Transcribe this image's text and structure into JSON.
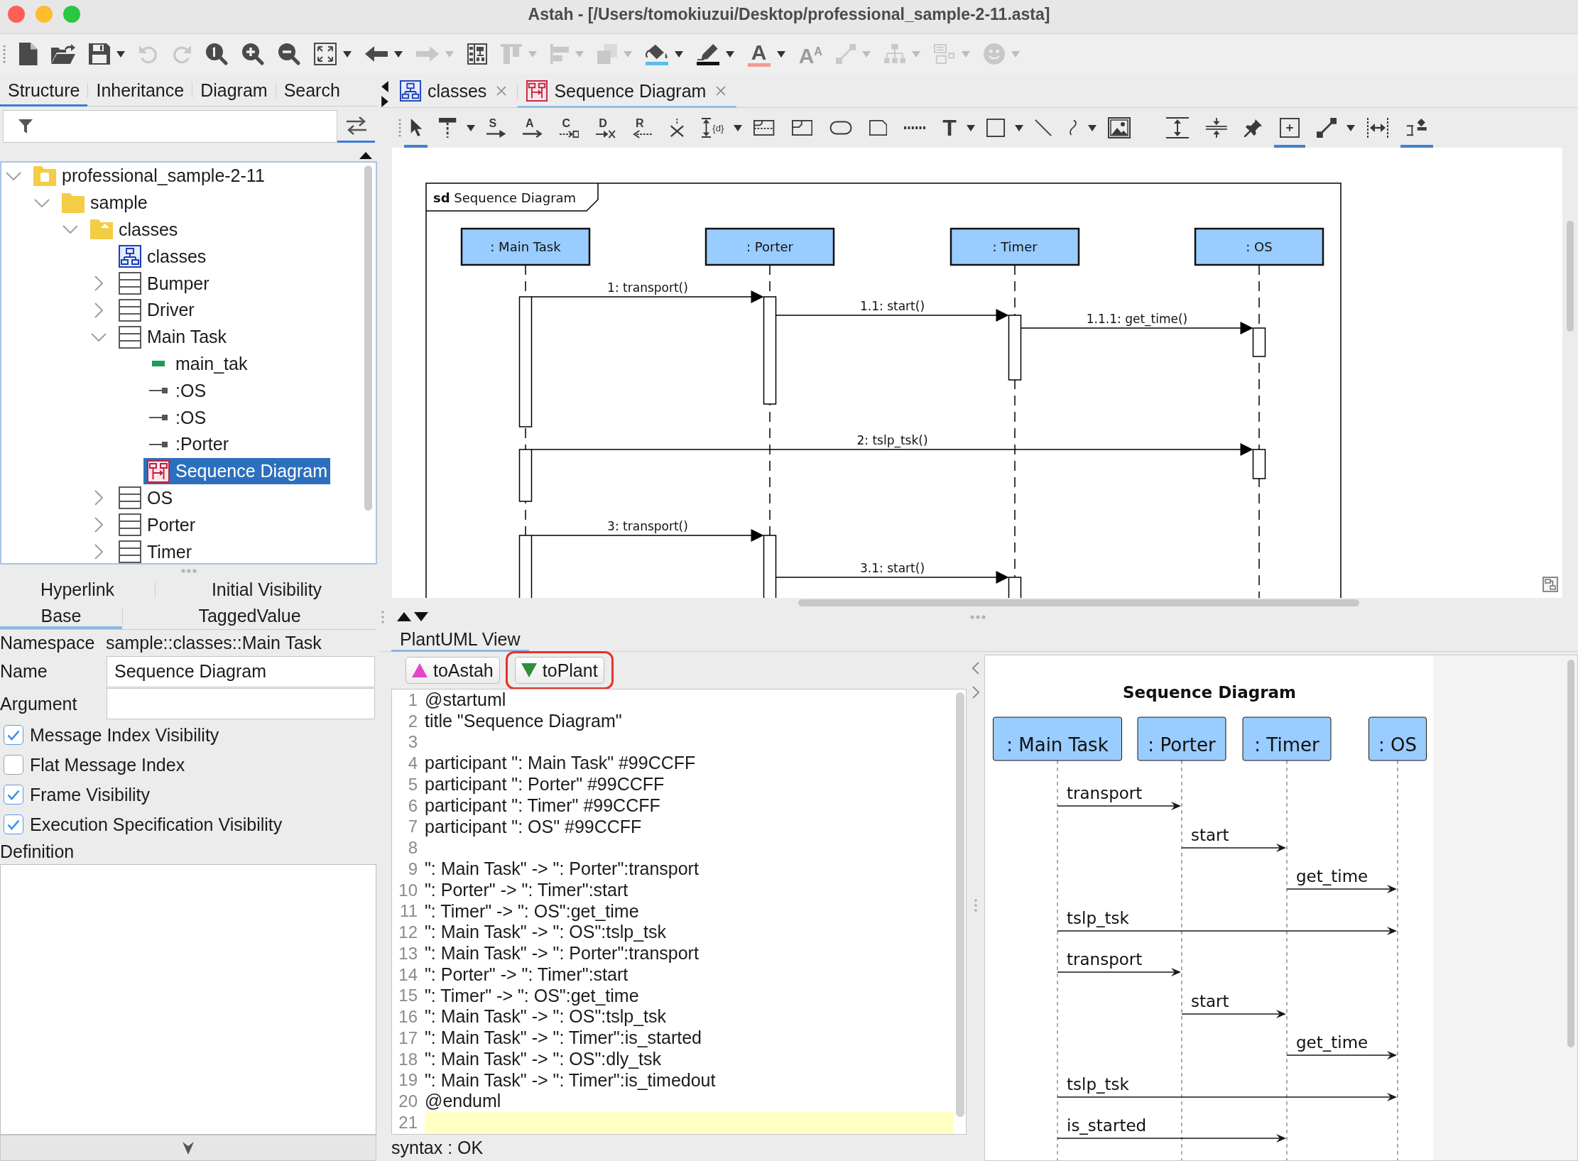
{
  "window": {
    "title": "Astah - [/Users/tomokiuzui/Desktop/professional_sample-2-11.asta]"
  },
  "toolbar": {
    "items": [
      {
        "kind": "new-file",
        "disabled": false,
        "dropdown": false
      },
      {
        "kind": "open-folder",
        "disabled": false,
        "dropdown": false
      },
      {
        "kind": "save",
        "disabled": false,
        "dropdown": true
      },
      {
        "kind": "undo",
        "disabled": true,
        "dropdown": false
      },
      {
        "kind": "redo",
        "disabled": true,
        "dropdown": false
      },
      {
        "kind": "zoom-reset",
        "disabled": false,
        "dropdown": false
      },
      {
        "kind": "zoom-in",
        "disabled": false,
        "dropdown": false
      },
      {
        "kind": "zoom-out",
        "disabled": false,
        "dropdown": false
      },
      {
        "kind": "fit-screen",
        "disabled": false,
        "dropdown": true
      },
      {
        "kind": "back",
        "disabled": false,
        "dropdown": true
      },
      {
        "kind": "forward",
        "disabled": true,
        "dropdown": true
      },
      {
        "kind": "layout",
        "disabled": false,
        "dropdown": false
      },
      {
        "kind": "align-top",
        "disabled": true,
        "dropdown": true
      },
      {
        "kind": "align-left",
        "disabled": true,
        "dropdown": true
      },
      {
        "kind": "layers",
        "disabled": true,
        "dropdown": true
      },
      {
        "kind": "paint-bucket",
        "disabled": false,
        "dropdown": true,
        "color": "#5bbcf0"
      },
      {
        "kind": "pen",
        "disabled": false,
        "dropdown": true,
        "color": "#111111"
      },
      {
        "kind": "font-color",
        "glyph": "A",
        "disabled": false,
        "dropdown": true,
        "color": "#f29a93"
      },
      {
        "kind": "font-size",
        "glyph": "A$^{A}$",
        "disabled": true,
        "dropdown": false
      },
      {
        "kind": "line-style",
        "disabled": true,
        "dropdown": true
      },
      {
        "kind": "tree-layout",
        "disabled": true,
        "dropdown": true
      },
      {
        "kind": "list-layout",
        "disabled": true,
        "dropdown": true
      },
      {
        "kind": "smiley",
        "disabled": true,
        "dropdown": true
      }
    ]
  },
  "structure": {
    "tabs": [
      {
        "label": "Structure",
        "selected": true
      },
      {
        "label": "Inheritance",
        "selected": false
      },
      {
        "label": "Diagram",
        "selected": false
      },
      {
        "label": "Search",
        "selected": false
      }
    ],
    "link_toggle": {
      "selected": true
    },
    "nodes": [
      {
        "label": "professional_sample-2-11",
        "kind": "project",
        "expanded": true,
        "selected": false,
        "children": [
          {
            "label": "sample",
            "kind": "folder",
            "expanded": true,
            "selected": false,
            "children": [
              {
                "label": "classes",
                "kind": "package",
                "expanded": true,
                "selected": false,
                "children": [
                  {
                    "label": "classes",
                    "kind": "class-diagram",
                    "selected": false
                  },
                  {
                    "label": "Bumper",
                    "kind": "class",
                    "expanded": false,
                    "selected": false
                  },
                  {
                    "label": "Driver",
                    "kind": "class",
                    "expanded": false,
                    "selected": false
                  },
                  {
                    "label": "Main Task",
                    "kind": "class",
                    "expanded": true,
                    "selected": false,
                    "children": [
                      {
                        "label": "main_tak",
                        "kind": "attribute",
                        "selected": false
                      },
                      {
                        "label": ":OS",
                        "kind": "association-end",
                        "selected": false
                      },
                      {
                        "label": ":OS",
                        "kind": "association-end",
                        "selected": false
                      },
                      {
                        "label": ":Porter",
                        "kind": "association-end",
                        "selected": false
                      },
                      {
                        "label": "Sequence Diagram",
                        "kind": "sequence-diagram",
                        "selected": true
                      }
                    ]
                  },
                  {
                    "label": "OS",
                    "kind": "class",
                    "expanded": false,
                    "selected": false
                  },
                  {
                    "label": "Porter",
                    "kind": "class",
                    "expanded": false,
                    "selected": false
                  },
                  {
                    "label": "Timer",
                    "kind": "class",
                    "expanded": false,
                    "selected": false
                  }
                ]
              }
            ]
          }
        ]
      }
    ]
  },
  "properties": {
    "tab_rows": [
      [
        {
          "label": "Hyperlink",
          "selected": false
        },
        {
          "label": "Initial Visibility",
          "selected": false
        }
      ],
      [
        {
          "label": "Base",
          "selected": true
        },
        {
          "label": "TaggedValue",
          "selected": false
        }
      ]
    ],
    "namespace": {
      "label": "Namespace",
      "value": "sample::classes::Main Task"
    },
    "fields": [
      {
        "label": "Name",
        "value": "Sequence Diagram"
      },
      {
        "label": "Argument"
      }
    ],
    "checkboxes": [
      {
        "label": "Message Index Visibility",
        "checked": true
      },
      {
        "label": "Flat Message Index",
        "checked": false
      },
      {
        "label": "Frame Visibility",
        "checked": true
      },
      {
        "label": "Execution Specification Visibility",
        "checked": true
      }
    ],
    "definition": {
      "label": "Definition"
    }
  },
  "editor_tabs": [
    {
      "label": "classes",
      "kind": "class-diagram",
      "selected": false
    },
    {
      "label": "Sequence Diagram",
      "kind": "sequence-diagram",
      "selected": true
    }
  ],
  "diagram_tools": {
    "groups": [
      [
        {
          "kind": "pointer",
          "selected": true,
          "dropdown": false
        },
        {
          "kind": "lifeline",
          "selected": false,
          "dropdown": true
        },
        {
          "kind": "sync-message",
          "glyph": "S",
          "selected": false,
          "dropdown": false
        },
        {
          "kind": "async-message",
          "glyph": "A",
          "selected": false,
          "dropdown": false
        },
        {
          "kind": "create-message",
          "glyph": "C",
          "selected": false,
          "dropdown": false
        },
        {
          "kind": "destroy-message",
          "glyph": "D",
          "selected": false,
          "dropdown": false
        },
        {
          "kind": "return-message",
          "glyph": "R",
          "selected": false,
          "dropdown": false
        },
        {
          "kind": "stop",
          "selected": false,
          "dropdown": false
        },
        {
          "kind": "duration",
          "glyph": "{d}",
          "selected": false,
          "dropdown": true
        },
        {
          "kind": "fragment",
          "selected": false,
          "dropdown": false
        },
        {
          "kind": "interaction-use",
          "selected": false,
          "dropdown": false
        },
        {
          "kind": "rounded-rectangle",
          "selected": false,
          "dropdown": false
        },
        {
          "kind": "note",
          "selected": false,
          "dropdown": false
        },
        {
          "kind": "dotted-line",
          "selected": false,
          "dropdown": false
        },
        {
          "kind": "text",
          "glyph": "T",
          "selected": false,
          "dropdown": true
        },
        {
          "kind": "rectangle",
          "selected": false,
          "dropdown": true
        },
        {
          "kind": "line",
          "selected": false,
          "dropdown": false
        },
        {
          "kind": "curve",
          "selected": false,
          "dropdown": true
        },
        {
          "kind": "image",
          "selected": false,
          "dropdown": false
        }
      ],
      [
        {
          "kind": "expand-vertical",
          "selected": false,
          "dropdown": false
        },
        {
          "kind": "compress-vertical",
          "selected": false,
          "dropdown": false
        },
        {
          "kind": "pin",
          "selected": false,
          "dropdown": false
        },
        {
          "kind": "add-box",
          "selected": true,
          "dropdown": false
        },
        {
          "kind": "connector",
          "selected": false,
          "dropdown": true
        },
        {
          "kind": "fit-width",
          "selected": false,
          "dropdown": false
        },
        {
          "kind": "diamond-bars",
          "selected": true,
          "dropdown": false
        }
      ]
    ]
  },
  "diagram": {
    "frame_kind": "sd",
    "frame_name": "Sequence Diagram",
    "lifelines": [
      ": Main Task",
      ": Porter",
      ": Timer",
      ": OS"
    ],
    "messages": [
      "1: transport()",
      "1.1: start()",
      "1.1.1: get_time()",
      "2: tslp_tsk()",
      "3: transport()",
      "3.1: start()"
    ]
  },
  "plantuml": {
    "tabs": [
      {
        "label": "PlantUML View",
        "selected": true
      }
    ],
    "buttons": [
      {
        "label": "toAstah",
        "kind": "to-astah",
        "highlighted": false
      },
      {
        "label": "toPlant",
        "kind": "to-plant",
        "highlighted": true
      }
    ],
    "lines": [
      {
        "number": "1",
        "text": "@startuml",
        "current": false
      },
      {
        "number": "2",
        "text": "title \"Sequence Diagram\"",
        "current": false
      },
      {
        "number": "3",
        "current": false
      },
      {
        "number": "4",
        "text": "participant \": Main Task\" #99CCFF",
        "current": false
      },
      {
        "number": "5",
        "text": "participant \": Porter\" #99CCFF",
        "current": false
      },
      {
        "number": "6",
        "text": "participant \": Timer\" #99CCFF",
        "current": false
      },
      {
        "number": "7",
        "text": "participant \": OS\" #99CCFF",
        "current": false
      },
      {
        "number": "8",
        "current": false
      },
      {
        "number": "9",
        "text": "\": Main Task\" -> \": Porter\":transport",
        "current": false
      },
      {
        "number": "10",
        "text": "\": Porter\" -> \": Timer\":start",
        "current": false
      },
      {
        "number": "11",
        "text": "\": Timer\" -> \": OS\":get_time",
        "current": false
      },
      {
        "number": "12",
        "text": "\": Main Task\" -> \": OS\":tslp_tsk",
        "current": false
      },
      {
        "number": "13",
        "text": "\": Main Task\" -> \": Porter\":transport",
        "current": false
      },
      {
        "number": "14",
        "text": "\": Porter\" -> \": Timer\":start",
        "current": false
      },
      {
        "number": "15",
        "text": "\": Timer\" -> \": OS\":get_time",
        "current": false
      },
      {
        "number": "16",
        "text": "\": Main Task\" -> \": OS\":tslp_tsk",
        "current": false
      },
      {
        "number": "17",
        "text": "\": Main Task\" -> \": Timer\":is_started",
        "current": false
      },
      {
        "number": "18",
        "text": "\": Main Task\" -> \": OS\":dly_tsk",
        "current": false
      },
      {
        "number": "19",
        "text": "\": Main Task\" -> \": Timer\":is_timedout",
        "current": false
      },
      {
        "number": "20",
        "text": "@enduml",
        "current": false
      },
      {
        "number": "21",
        "current": true
      }
    ],
    "status": "syntax : OK",
    "preview": {
      "title": "Sequence Diagram",
      "participants": [
        ": Main Task",
        ": Porter",
        ": Timer",
        ": OS"
      ],
      "messages": [
        "transport",
        "start",
        "get_time",
        "tslp_tsk",
        "transport",
        "start",
        "get_time",
        "tslp_tsk",
        "is_started"
      ]
    }
  }
}
